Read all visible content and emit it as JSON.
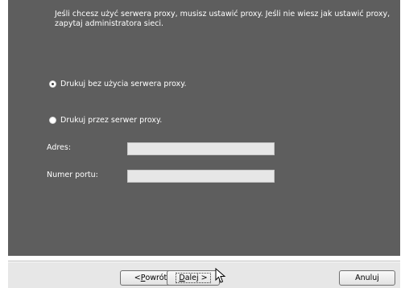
{
  "intro_text": "Jeśli chcesz użyć serwera proxy, musisz ustawić proxy. Jeśli nie wiesz jak ustawić proxy, zapytaj administratora sieci.",
  "options": [
    {
      "label": "Drukuj bez użycia serwera proxy.",
      "selected": true
    },
    {
      "label": "Drukuj przez serwer proxy.",
      "selected": false
    }
  ],
  "fields": {
    "address": {
      "label": "Adres:",
      "value": ""
    },
    "port": {
      "label": "Numer portu:",
      "value": ""
    }
  },
  "buttons": {
    "back": {
      "prefix": "< ",
      "mnemonic": "P",
      "rest": "owrót"
    },
    "next": {
      "mnemonic": "D",
      "rest": "alej >"
    },
    "cancel": {
      "label": "Anuluj"
    }
  },
  "colors": {
    "panel": "#5e5e5e",
    "bottom_bar": "#e7e7e7"
  },
  "icons": [
    "radio-selected-icon",
    "radio-unselected-icon",
    "mouse-pointer-icon"
  ]
}
